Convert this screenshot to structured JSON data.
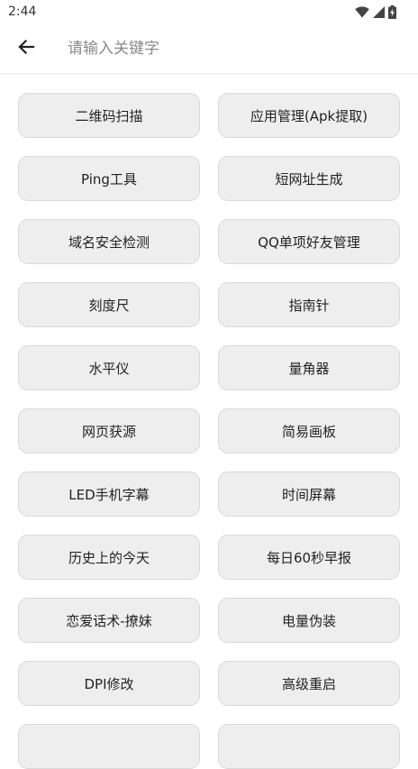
{
  "status_bar": {
    "time": "2:44",
    "icons": [
      "wifi-icon",
      "signal-icon",
      "battery-charging-icon"
    ]
  },
  "app_bar": {
    "back_icon": "arrow-back-icon",
    "search_placeholder": "请输入关键字",
    "search_value": ""
  },
  "tools": [
    {
      "label": "二维码扫描"
    },
    {
      "label": "应用管理(Apk提取)"
    },
    {
      "label": "Ping工具"
    },
    {
      "label": "短网址生成"
    },
    {
      "label": "域名安全检测"
    },
    {
      "label": "QQ单项好友管理"
    },
    {
      "label": "刻度尺"
    },
    {
      "label": "指南针"
    },
    {
      "label": "水平仪"
    },
    {
      "label": "量角器"
    },
    {
      "label": "网页获源"
    },
    {
      "label": "简易画板"
    },
    {
      "label": "LED手机字幕"
    },
    {
      "label": "时间屏幕"
    },
    {
      "label": "历史上的今天"
    },
    {
      "label": "每日60秒早报"
    },
    {
      "label": "恋爱话术-撩妹"
    },
    {
      "label": "电量伪装"
    },
    {
      "label": "DPI修改"
    },
    {
      "label": "高级重启"
    },
    {
      "label": ""
    },
    {
      "label": ""
    }
  ]
}
